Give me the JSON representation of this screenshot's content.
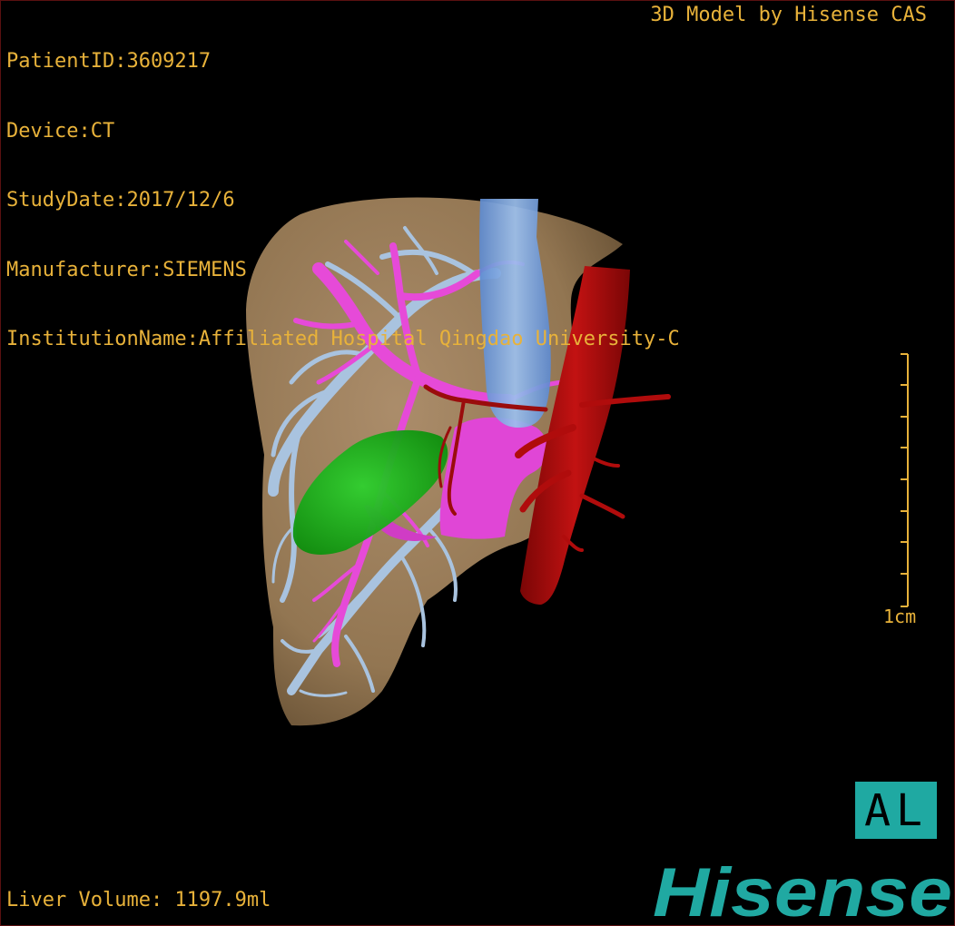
{
  "patient_info": {
    "patient_id": "PatientID:3609217",
    "device": "Device:CT",
    "study_date": "StudyDate:2017/12/6",
    "manufacturer": "Manufacturer:SIEMENS",
    "institution": "InstitutionName:Affiliated Hospital Qingdao University-C"
  },
  "watermark": "3D Model by Hisense CAS",
  "liver_volume": "Liver Volume: 1197.9ml",
  "scale": {
    "label": "1cm"
  },
  "orientation": "AL",
  "brand": "Hisense",
  "colors": {
    "overlay_text": "#e8b23a",
    "liver": "#a88862",
    "hepatic_vein": "#a9c3df",
    "portal_vein": "#e64ad8",
    "aorta": "#b00c0c",
    "ivc": "#7aa6e0",
    "gallbladder": "#14b414",
    "brand": "#20a9a2"
  }
}
